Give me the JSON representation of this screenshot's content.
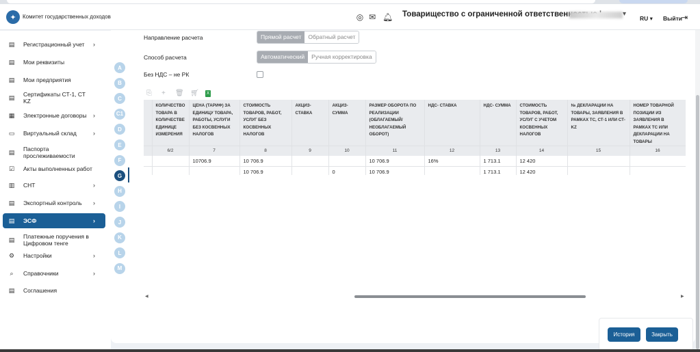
{
  "header": {
    "logo_text": "Комитет государственных доходов",
    "org_name": "Товарищество с ограниченной ответственностью '",
    "lang": "RU ▾",
    "logout": "Выйти"
  },
  "sidebar": {
    "items": [
      {
        "label": "Регистрационный учет",
        "icon": "document-icon",
        "glyph": "▤",
        "chevron": true,
        "active": false
      },
      {
        "label": "Мои реквизиты",
        "icon": "document-icon",
        "glyph": "▤",
        "chevron": false,
        "active": false
      },
      {
        "label": "Мои предприятия",
        "icon": "document-icon",
        "glyph": "▤",
        "chevron": false,
        "active": false
      },
      {
        "label": "Сертификаты СТ-1, СТ KZ",
        "icon": "document-icon",
        "glyph": "▤",
        "chevron": false,
        "active": false
      },
      {
        "label": "Электронные договоры",
        "icon": "grid-icon",
        "glyph": "▦",
        "chevron": true,
        "active": false
      },
      {
        "label": "Виртуальный склад",
        "icon": "folder-icon",
        "glyph": "▭",
        "chevron": true,
        "active": false
      },
      {
        "label": "Паспорта прослеживаемости",
        "icon": "document-icon",
        "glyph": "▤",
        "chevron": false,
        "active": false
      },
      {
        "label": "Акты выполненных работ",
        "icon": "check-square-icon",
        "glyph": "☑",
        "chevron": false,
        "active": false
      },
      {
        "label": "СНТ",
        "icon": "columns-icon",
        "glyph": "▥",
        "chevron": true,
        "active": false
      },
      {
        "label": "Экспортный контроль",
        "icon": "document-icon",
        "glyph": "▤",
        "chevron": true,
        "active": false
      },
      {
        "label": "ЭСФ",
        "icon": "document-icon",
        "glyph": "▤",
        "chevron": true,
        "active": true
      },
      {
        "label": "Платежные поручения в Цифровом тенге",
        "icon": "document-icon",
        "glyph": "▤",
        "chevron": false,
        "active": false
      },
      {
        "label": "Настройки",
        "icon": "gear-icon",
        "glyph": "⚙",
        "chevron": true,
        "active": false
      },
      {
        "label": "Справочники",
        "icon": "book-search-icon",
        "glyph": "⌕",
        "chevron": true,
        "active": false
      },
      {
        "label": "Соглашения",
        "icon": "document-icon",
        "glyph": "▤",
        "chevron": false,
        "active": false
      }
    ]
  },
  "sections": {
    "letters": [
      "A",
      "B",
      "C",
      "C1",
      "D",
      "E",
      "F",
      "G",
      "H",
      "I",
      "J",
      "K",
      "L",
      "M"
    ],
    "active": "G"
  },
  "form": {
    "direction_label": "Направление расчета",
    "direction_options": [
      "Прямой расчет",
      "Обратный расчет"
    ],
    "direction_selected": "Прямой расчет",
    "method_label": "Способ расчета",
    "method_options": [
      "Автоматический",
      "Ручная корректировка"
    ],
    "method_selected": "Автоматический",
    "vat_label": "Без НДС – не РК"
  },
  "toolbar": {
    "icons": [
      "copy-icon",
      "add-icon",
      "delete-icon",
      "cart-icon",
      "excel-icon"
    ]
  },
  "table": {
    "headers": [
      "",
      "Количество товара в количестве единице измерения",
      "Цена (тариф) за единицу товара, работы, услуги без косвенных налогов",
      "Стоимость товаров, работ, услуг без косвенных налогов",
      "Акциз-ставка",
      "Акциз-сумма",
      "Размер оборота по реализации (облагаемый/ необлагаемый оборот)",
      "НДС- ставка",
      "НДС- сумма",
      "Стоимость товаров, работ, услуг с учетом косвенных налогов",
      "№ декларации на товары, заявления в рамках ТС, СТ-1 или СТ-KZ",
      "Номер товарной позиции из заявления в рамках ТС или декларации на товары"
    ],
    "numbers": [
      "",
      "6/2",
      "7",
      "8",
      "9",
      "10",
      "11",
      "12",
      "13",
      "14",
      "15",
      "16"
    ],
    "rows": [
      [
        "",
        "",
        "10706.9",
        "10 706.9",
        "",
        "",
        "10 706.9",
        "16%",
        "1 713.1",
        "12 420",
        "",
        ""
      ],
      [
        "",
        "",
        "",
        "10 706.9",
        "",
        "0",
        "10 706.9",
        "",
        "1 713.1",
        "12 420",
        "",
        ""
      ]
    ]
  },
  "footer": {
    "history_label": "История",
    "close_label": "Закрыть"
  },
  "colors": {
    "primary": "#1b5f96",
    "letter_inactive": "#b8d4ea",
    "letter_active": "#1b4f7e",
    "segment_on": "#a8acb2"
  }
}
